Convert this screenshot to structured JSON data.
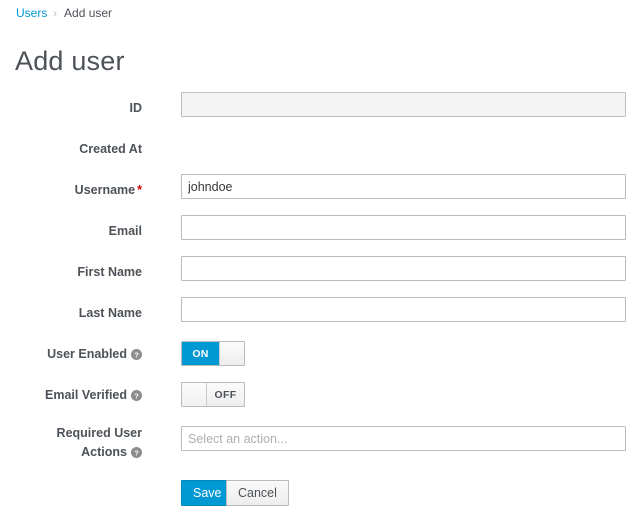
{
  "breadcrumb": {
    "parent": "Users",
    "separator": "›",
    "current": "Add user"
  },
  "page": {
    "title": "Add user"
  },
  "form": {
    "fields": [
      {
        "label": "ID",
        "required": false,
        "help": false,
        "type": "text",
        "value": "",
        "placeholder": "",
        "disabled": true
      },
      {
        "label": "Created At",
        "required": false,
        "help": false,
        "type": "none",
        "value": "",
        "placeholder": "",
        "disabled": false
      },
      {
        "label": "Username",
        "required": true,
        "help": false,
        "type": "text",
        "value": "johndoe",
        "placeholder": "",
        "disabled": false
      },
      {
        "label": "Email",
        "required": false,
        "help": false,
        "type": "text",
        "value": "",
        "placeholder": "",
        "disabled": false
      },
      {
        "label": "First Name",
        "required": false,
        "help": false,
        "type": "text",
        "value": "",
        "placeholder": "",
        "disabled": false
      },
      {
        "label": "Last Name",
        "required": false,
        "help": false,
        "type": "text",
        "value": "",
        "placeholder": "",
        "disabled": false
      },
      {
        "label": "User Enabled",
        "required": false,
        "help": true,
        "type": "switch",
        "state": "on",
        "on_label": "ON",
        "off_label": "OFF"
      },
      {
        "label": "Email Verified",
        "required": false,
        "help": true,
        "type": "switch",
        "state": "off",
        "on_label": "ON",
        "off_label": "OFF"
      },
      {
        "label_line1": "Required User",
        "label_line2": "Actions",
        "required": false,
        "help": true,
        "type": "select",
        "value": "",
        "placeholder": "Select an action..."
      }
    ]
  },
  "actions": {
    "save_label": "Save",
    "cancel_label": "Cancel"
  },
  "icons": {
    "help": "help-circle-icon",
    "breadcrumb_separator": "chevron-right-icon"
  },
  "colors": {
    "link": "#0099d3",
    "primary": "#0099d3",
    "required_star": "#cc0000",
    "label_text": "#4d5258",
    "input_border": "#bbbbbb",
    "disabled_bg": "#f4f4f4",
    "help_icon": "#8b8d8f"
  }
}
